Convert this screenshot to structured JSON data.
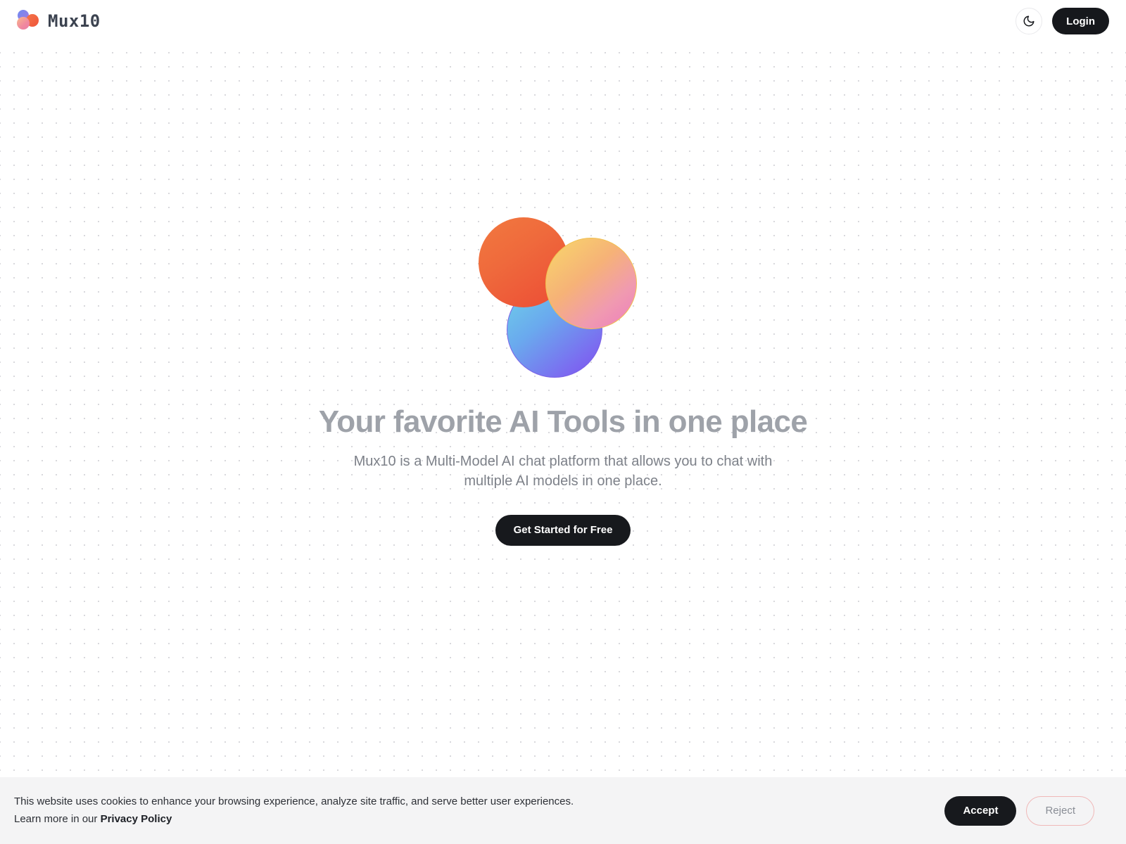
{
  "header": {
    "brand_name": "Mux10",
    "logo_icon": "three-circles-logo",
    "theme_toggle_icon": "moon-icon",
    "login_label": "Login"
  },
  "hero": {
    "graphic_icon": "three-overlapping-gradient-circles",
    "title": "Your favorite AI Tools in one place",
    "subtitle": "Mux10 is a Multi-Model AI chat platform that allows you to chat with multiple AI models in one place.",
    "cta_label": "Get Started for Free"
  },
  "cookie_banner": {
    "message_line1": "This website uses cookies to enhance your browsing experience, analyze site traffic, and serve better user experiences.",
    "message_line2_prefix": "Learn more in our ",
    "policy_link_label": "Privacy Policy",
    "accept_label": "Accept",
    "reject_label": "Reject"
  },
  "colors": {
    "page_background": "#ffffff",
    "dot_pattern": "#d8d8dc",
    "dark_button": "#17191d",
    "heading_gray": "#9ea2a9",
    "body_gray": "#7d8189",
    "banner_background": "#f4f4f5",
    "reject_border": "#f0b8b8",
    "logo_blue": "#6f8bf2",
    "logo_orange": "#ef5339",
    "logo_pink": "#ea7da6",
    "hero_orange": "#ec4b35",
    "hero_yellow": "#f8d86a",
    "hero_pink": "#ed7cc0",
    "hero_cyan": "#6ed2e8",
    "hero_purple": "#7a51ef"
  }
}
